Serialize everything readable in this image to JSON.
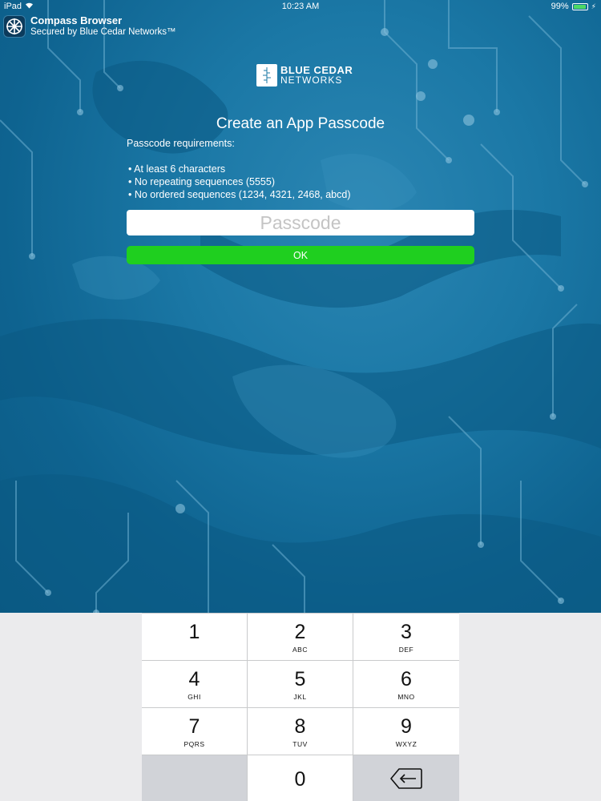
{
  "status_bar": {
    "device": "iPad",
    "time": "10:23 AM",
    "battery": "99%",
    "battery_level": 0.99
  },
  "app": {
    "title": "Compass Browser",
    "subtitle": "Secured by Blue Cedar Networks™",
    "icon": "compass-icon"
  },
  "logo": {
    "line1": "BLUE CEDAR",
    "line2": "NETWORKS"
  },
  "form": {
    "title": "Create an App Passcode",
    "requirements_heading": "Passcode requirements:",
    "requirements": [
      "At least 6 characters",
      "No repeating sequences (5555)",
      "No ordered sequences (1234, 4321, 2468, abcd)"
    ],
    "passcode_placeholder": "Passcode",
    "ok_label": "OK"
  },
  "keypad": {
    "keys": [
      {
        "num": "1",
        "letters": ""
      },
      {
        "num": "2",
        "letters": "ABC"
      },
      {
        "num": "3",
        "letters": "DEF"
      },
      {
        "num": "4",
        "letters": "GHI"
      },
      {
        "num": "5",
        "letters": "JKL"
      },
      {
        "num": "6",
        "letters": "MNO"
      },
      {
        "num": "7",
        "letters": "PQRS"
      },
      {
        "num": "8",
        "letters": "TUV"
      },
      {
        "num": "9",
        "letters": "WXYZ"
      },
      {
        "num": "0",
        "letters": ""
      }
    ],
    "backspace_icon": "backspace-icon"
  },
  "colors": {
    "ok_button": "#1fcf1f",
    "background": "#0f6a96"
  }
}
